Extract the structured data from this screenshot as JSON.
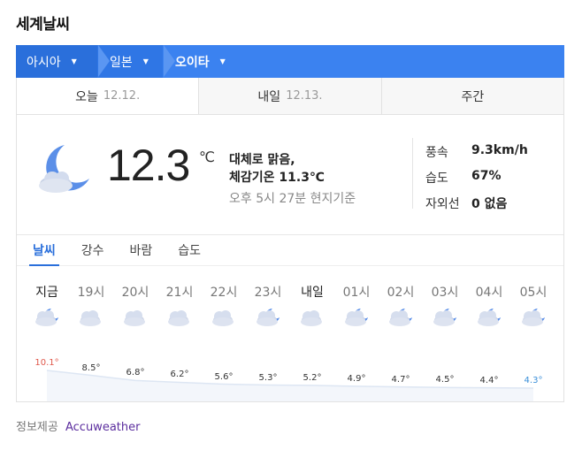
{
  "title": "세계날씨",
  "breadcrumb": [
    {
      "label": "아시아"
    },
    {
      "label": "일본"
    },
    {
      "label": "오이타"
    }
  ],
  "tabs": [
    {
      "label": "오늘",
      "date": "12.12."
    },
    {
      "label": "내일",
      "date": "12.13."
    },
    {
      "label": "주간",
      "date": ""
    }
  ],
  "current": {
    "temp": "12.3",
    "unit": "℃",
    "condition": "대체로 맑음,",
    "feels_like": "체감기온 11.3℃",
    "observed": "오후 5시 27분 현지기준",
    "stats": [
      {
        "label": "풍속",
        "value": "9.3km/h"
      },
      {
        "label": "습도",
        "value": "67%"
      },
      {
        "label": "자외선",
        "value": "0 없음"
      }
    ]
  },
  "subtabs": [
    "날씨",
    "강수",
    "바람",
    "습도"
  ],
  "hourly": [
    {
      "time": "지금",
      "temp": "10.1°",
      "t": 10.1
    },
    {
      "time": "19시",
      "temp": "8.5°",
      "t": 8.5
    },
    {
      "time": "20시",
      "temp": "6.8°",
      "t": 6.8
    },
    {
      "time": "21시",
      "temp": "6.2°",
      "t": 6.2
    },
    {
      "time": "22시",
      "temp": "5.6°",
      "t": 5.6
    },
    {
      "time": "23시",
      "temp": "5.3°",
      "t": 5.3
    },
    {
      "time": "내일",
      "temp": "5.2°",
      "t": 5.2
    },
    {
      "time": "01시",
      "temp": "4.9°",
      "t": 4.9
    },
    {
      "time": "02시",
      "temp": "4.7°",
      "t": 4.7
    },
    {
      "time": "03시",
      "temp": "4.5°",
      "t": 4.5
    },
    {
      "time": "04시",
      "temp": "4.4°",
      "t": 4.4
    },
    {
      "time": "05시",
      "temp": "4.3°",
      "t": 4.3
    }
  ],
  "hourly_icons": [
    "cloudy-night-icon",
    "cloudy-icon",
    "cloudy-icon",
    "cloudy-icon",
    "cloudy-icon",
    "partly-cloudy-night-icon",
    "cloudy-icon",
    "partly-cloudy-night-icon",
    "partly-cloudy-night-icon",
    "partly-cloudy-night-icon",
    "partly-cloudy-night-icon",
    "partly-cloudy-night-icon"
  ],
  "credit": {
    "label": "정보제공",
    "source": "Accuweather"
  },
  "colors": {
    "accent": "#2a6fdb",
    "hot": "#e0584b",
    "cold": "#3b8fd9"
  }
}
